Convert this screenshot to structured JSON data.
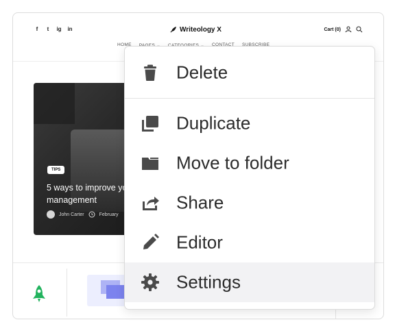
{
  "site": {
    "social": [
      "f",
      "t",
      "ig",
      "in"
    ],
    "brand": "Writeology X",
    "cart": "Cart (0)",
    "nav": [
      "HOME",
      "PAGES ⌄",
      "CATEGORIES ⌄",
      "CONTACT",
      "SUBSCRIBE"
    ]
  },
  "post": {
    "tag": "TIPS",
    "title_line1": "5 ways to improve yo",
    "title_line2": "management",
    "author": "John Carter",
    "date": "February"
  },
  "menu": {
    "items": [
      {
        "label": "Delete",
        "icon": "trash-icon"
      },
      {
        "label": "Duplicate",
        "icon": "duplicate-icon"
      },
      {
        "label": "Move to folder",
        "icon": "folder-icon"
      },
      {
        "label": "Share",
        "icon": "share-icon"
      },
      {
        "label": "Editor",
        "icon": "pencil-icon"
      },
      {
        "label": "Settings",
        "icon": "gear-icon"
      }
    ],
    "active": "Settings"
  },
  "colors": {
    "icon": "#4a4a4a",
    "accent_green": "#22b35e",
    "active_bg": "#f2f2f4"
  }
}
